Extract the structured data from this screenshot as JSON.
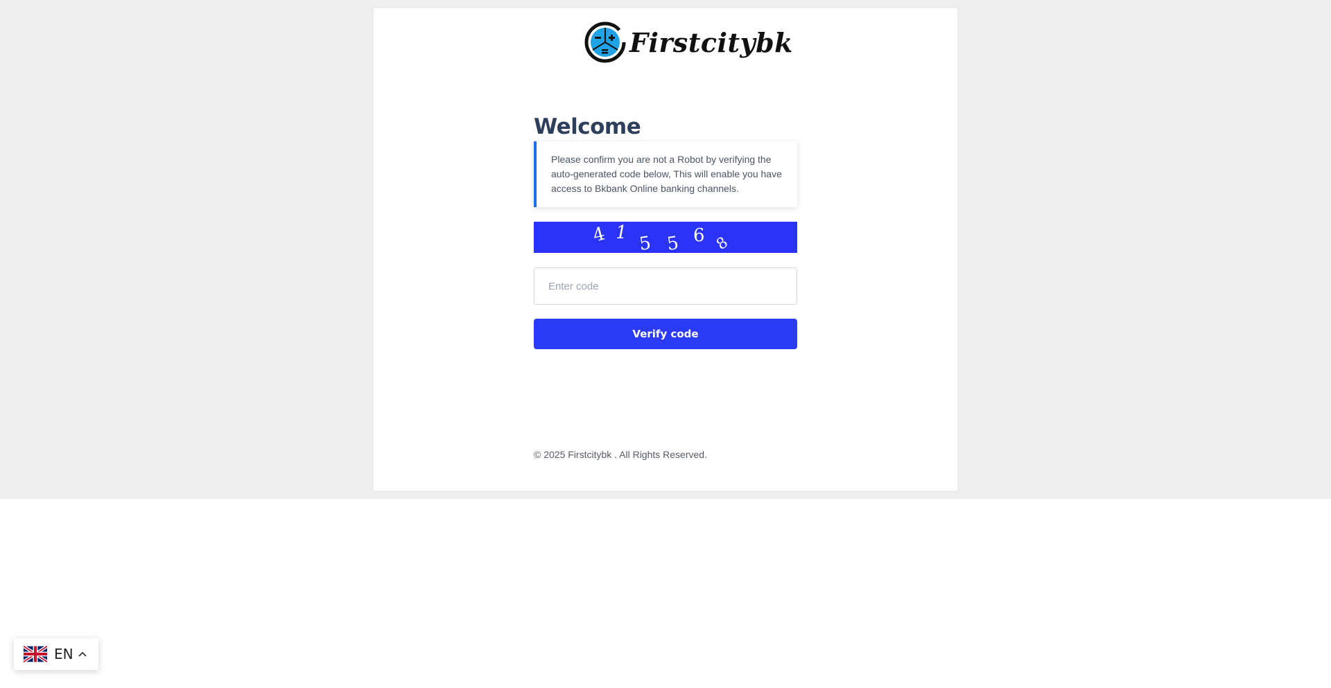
{
  "brand": {
    "name": "Firstcitybk",
    "colors": {
      "accent": "#2b3bf5",
      "logo_blue": "#1fa3e6",
      "notice_border": "#1f6fe8"
    }
  },
  "heading": "Welcome",
  "notice": {
    "text": "Please confirm you are not a Robot by verifying the auto-generated code below, This will enable you have access to Bkbank Online banking channels."
  },
  "captcha": {
    "characters": [
      "4",
      "1",
      "5",
      "5",
      "6",
      "8"
    ]
  },
  "code_input": {
    "placeholder": "Enter code",
    "value": ""
  },
  "verify_button": {
    "label": "Verify code"
  },
  "footer": {
    "text": "© 2025 Firstcitybk . All Rights Reserved."
  },
  "language": {
    "code": "EN",
    "flag_icon": "uk-flag-icon",
    "chevron_icon": "chevron-up-icon"
  }
}
